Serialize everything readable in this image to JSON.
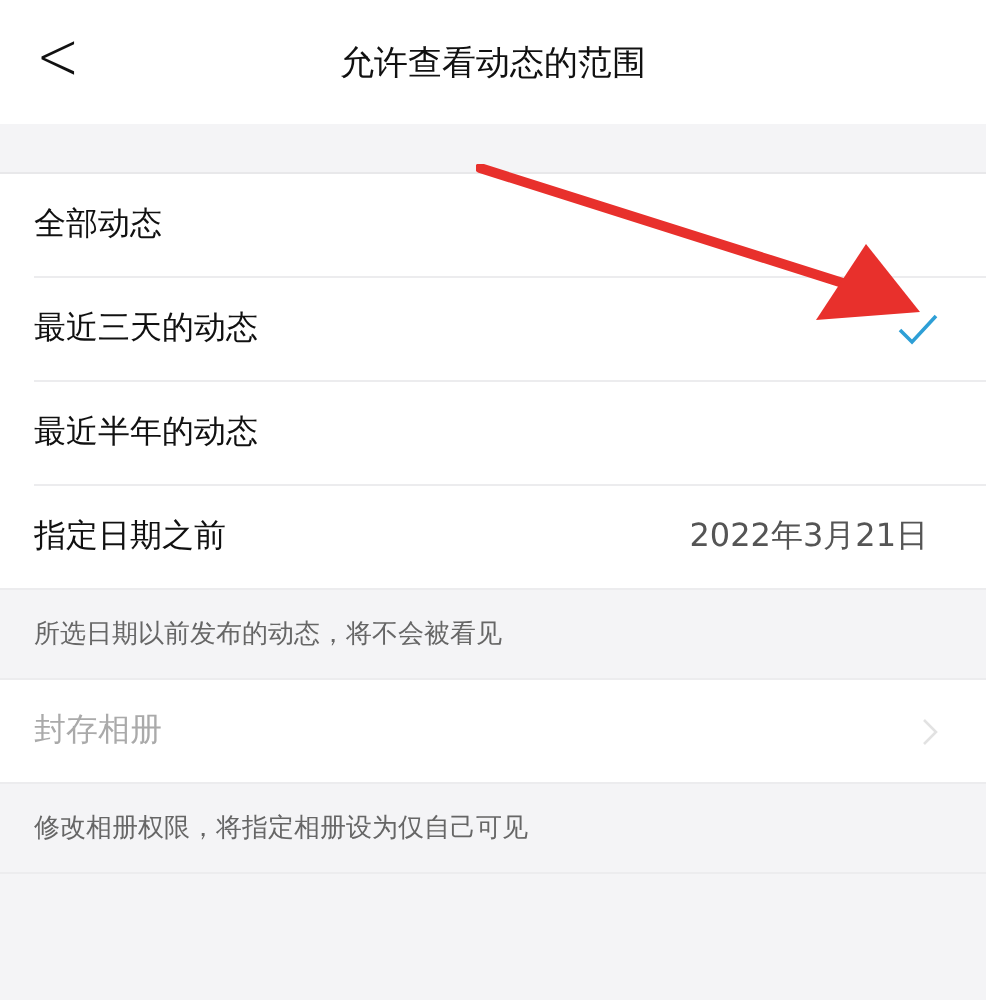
{
  "nav": {
    "back": "<",
    "title": "允许查看动态的范围"
  },
  "options": [
    {
      "label": "全部动态",
      "selected": false
    },
    {
      "label": "最近三天的动态",
      "selected": true
    },
    {
      "label": "最近半年的动态",
      "selected": false
    },
    {
      "label": "指定日期之前",
      "selected": false,
      "value": "2022年3月21日"
    }
  ],
  "options_note": "所选日期以前发布的动态，将不会被看见",
  "album": {
    "label": "封存相册",
    "disabled": true
  },
  "album_note": "修改相册权限，将指定相册设为仅自己可见",
  "annotation": {
    "kind": "arrow"
  }
}
